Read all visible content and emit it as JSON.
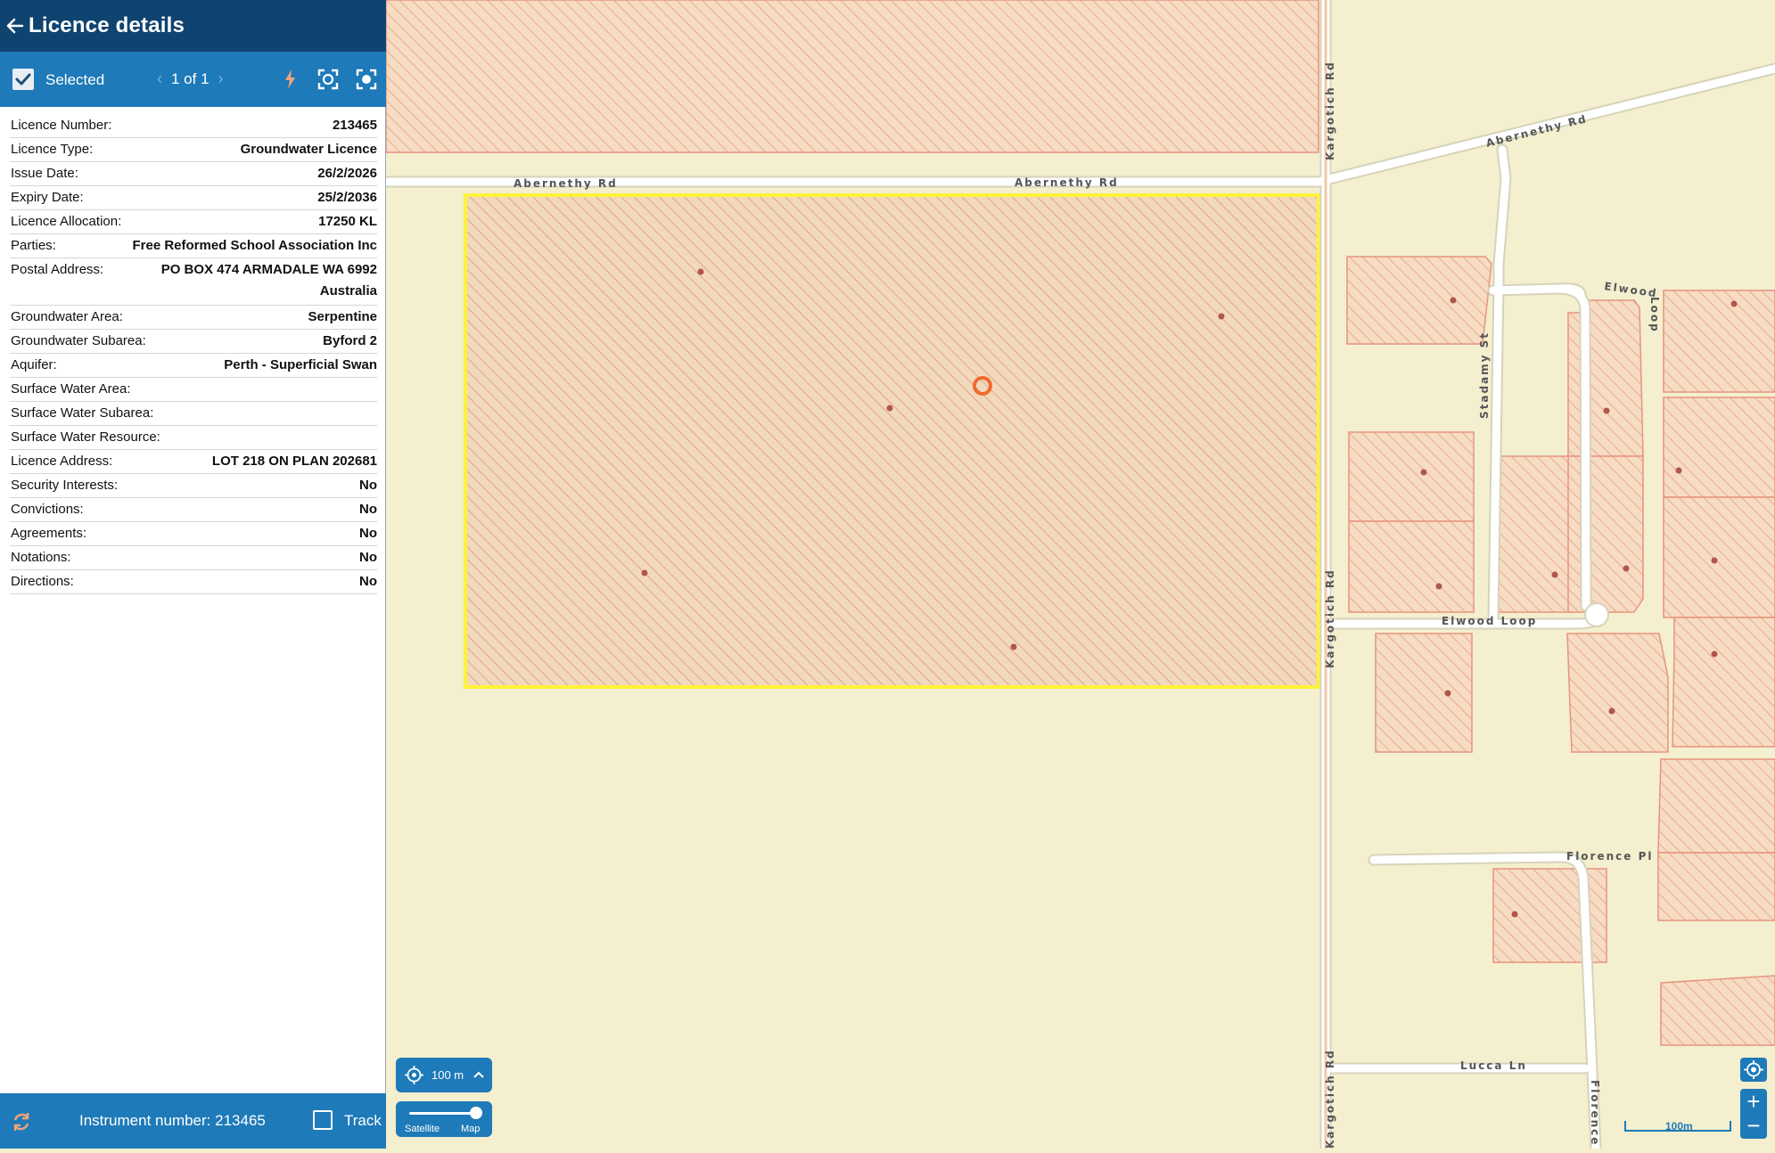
{
  "panel": {
    "title": "Licence details",
    "toolbar": {
      "selected_label": "Selected",
      "pager": "1 of 1"
    },
    "details": [
      {
        "label": "Licence Number:",
        "value": "213465"
      },
      {
        "label": "Licence Type:",
        "value": "Groundwater Licence"
      },
      {
        "label": "Issue Date:",
        "value": "26/2/2026"
      },
      {
        "label": "Expiry Date:",
        "value": "25/2/2036"
      },
      {
        "label": "Licence Allocation:",
        "value": "17250 KL"
      },
      {
        "label": "Parties:",
        "value": "Free Reformed School Association Inc"
      },
      {
        "label": "Postal Address:",
        "value": "PO BOX 474 ARMADALE WA 6992",
        "value2": "Australia"
      },
      {
        "label": "Groundwater Area:",
        "value": "Serpentine"
      },
      {
        "label": "Groundwater Subarea:",
        "value": "Byford 2"
      },
      {
        "label": "Aquifer:",
        "value": "Perth - Superficial Swan"
      },
      {
        "label": "Surface Water Area:",
        "value": ""
      },
      {
        "label": "Surface Water Subarea:",
        "value": ""
      },
      {
        "label": "Surface Water Resource:",
        "value": ""
      },
      {
        "label": "Licence Address:",
        "value": "LOT 218 ON PLAN 202681"
      },
      {
        "label": "Security Interests:",
        "value": "No"
      },
      {
        "label": "Convictions:",
        "value": "No"
      },
      {
        "label": "Agreements:",
        "value": "No"
      },
      {
        "label": "Notations:",
        "value": "No"
      },
      {
        "label": "Directions:",
        "value": "No"
      }
    ],
    "footer": {
      "instrument_label": "Instrument number: 213465",
      "track_label": "Track"
    }
  },
  "map": {
    "roads": {
      "abernethy_left": "Abernethy Rd",
      "abernethy_mid": "Abernethy Rd",
      "abernethy_right": "Abernethy Rd",
      "kargotich_top": "Kargotich Rd",
      "kargotich_mid": "Kargotich Rd",
      "kargotich_bottom": "Kargotich Rd",
      "stadamy": "Stadamy St",
      "elwood_top": "Elwood",
      "elwood_loop_side": "Loop",
      "elwood_loop": "Elwood Loop",
      "florence_pl": "Florence Pl",
      "lucca": "Lucca Ln",
      "florence_side": "Florence"
    },
    "controls": {
      "scale_text": "100 m",
      "basemap_left": "Satellite",
      "basemap_right": "Map",
      "scalebar_label": "100m"
    },
    "colors": {
      "land": "#f3efcf",
      "parcel_hatch": "#e7947f",
      "selected_outline": "#fff23a",
      "accent": "#1e7ab8",
      "header": "#0f4470",
      "marker": "#f06a2c"
    }
  }
}
